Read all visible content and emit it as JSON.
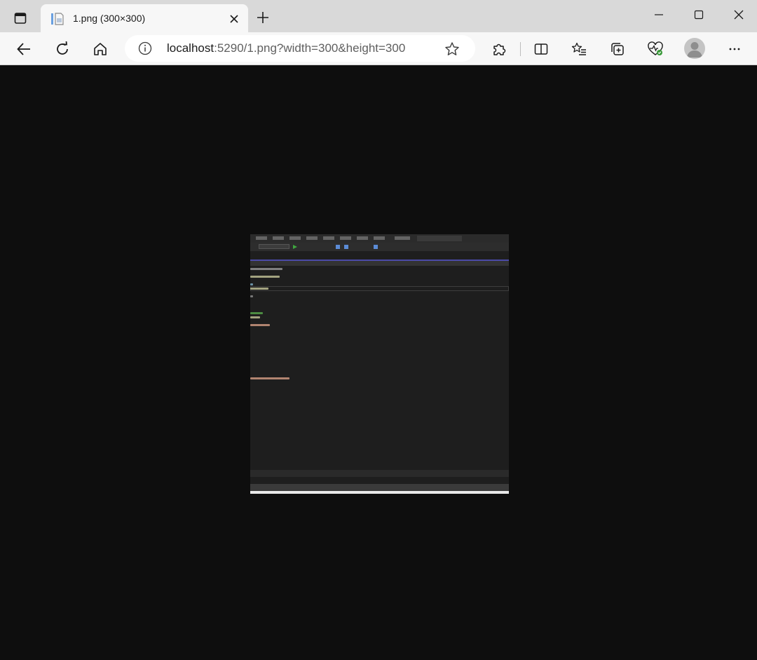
{
  "browser": {
    "tab": {
      "title": "1.png (300×300)"
    },
    "address": {
      "host": "localhost",
      "rest": ":5290/1.png?width=300&height=300"
    }
  },
  "content": {
    "image_dimensions": "300×300"
  },
  "icons": {
    "tab_actions": "tab-actions-icon",
    "favicon": "image-file-icon",
    "close": "close-icon",
    "new_tab": "plus-icon",
    "minimize": "minimize-icon",
    "maximize": "maximize-icon",
    "window_close": "close-icon",
    "back": "back-arrow-icon",
    "refresh": "refresh-icon",
    "home": "home-icon",
    "info": "info-icon",
    "favorite": "star-icon",
    "extensions": "puzzle-icon",
    "split_screen": "split-screen-icon",
    "favorites": "favorites-list-icon",
    "collections": "collections-icon",
    "performance": "heartbeat-icon",
    "profile": "avatar-icon",
    "more": "more-dots-icon"
  },
  "colors": {
    "titlebar": "#d9d9d9",
    "toolbar": "#f7f7f7",
    "viewport": "#0e0e0e",
    "ide_background": "#1e1e1e"
  }
}
